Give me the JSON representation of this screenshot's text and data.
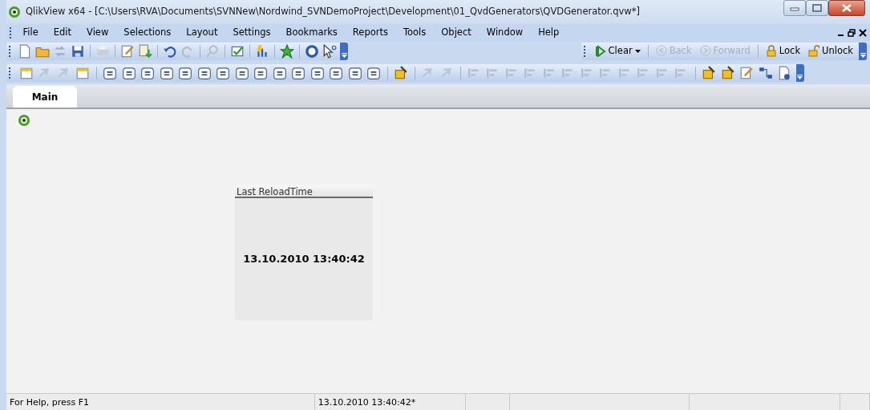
{
  "window": {
    "title": "QlikView x64 - [C:\\Users\\RVA\\Documents\\SVNNew\\Nordwind_SVNDemoProject\\Development\\01_QvdGenerators\\QVDGenerator.qvw*]"
  },
  "menu": [
    {
      "label": "File"
    },
    {
      "label": "Edit"
    },
    {
      "label": "View"
    },
    {
      "label": "Selections"
    },
    {
      "label": "Layout"
    },
    {
      "label": "Settings"
    },
    {
      "label": "Bookmarks"
    },
    {
      "label": "Reports"
    },
    {
      "label": "Tools"
    },
    {
      "label": "Object"
    },
    {
      "label": "Window"
    },
    {
      "label": "Help"
    }
  ],
  "selection_toolbar": [
    {
      "kind": "clear",
      "label": "Clear",
      "disabled": false
    },
    {
      "kind": "back",
      "label": "Back",
      "disabled": true
    },
    {
      "kind": "forward",
      "label": "Forward",
      "disabled": true
    },
    {
      "kind": "lock",
      "label": "Lock",
      "disabled": false
    },
    {
      "kind": "unlock",
      "label": "Unlock",
      "disabled": false
    }
  ],
  "tabs": [
    {
      "label": "Main",
      "selected": true
    }
  ],
  "sheet_object": {
    "caption": "Last ReloadTime",
    "value": "13.10.2010 13:40:42"
  },
  "status_bar": [
    "For Help, press F1",
    "13.10.2010 13:40:42*"
  ]
}
